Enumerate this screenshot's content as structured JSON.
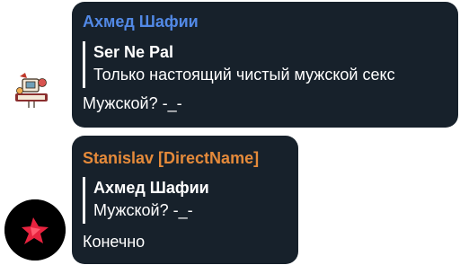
{
  "messages": [
    {
      "sender": "Ахмед Шафии",
      "sender_color": "#5289e6",
      "reply_author": "Ser Ne Pal",
      "reply_text": "Только настоящий чистый мужской секс",
      "text": "Мужской? -_-",
      "avatar_icon": "hello-world-sticker-icon"
    },
    {
      "sender": "Stanislav [DirectName]",
      "sender_color": "#e58a3a",
      "reply_author": "Ахмед Шафии",
      "reply_text": "Мужской? -_-",
      "text": "Конечно",
      "avatar_icon": "red-star-logo-icon"
    }
  ],
  "colors": {
    "bubble_bg": "#17212b",
    "text": "#ffffff"
  }
}
